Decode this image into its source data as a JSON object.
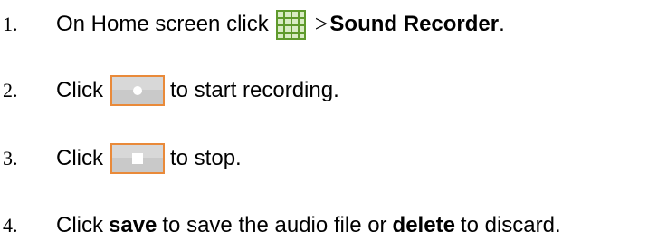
{
  "steps": [
    {
      "number": "1.",
      "before": "On Home screen click",
      "arrow": ">",
      "bold_after": "Sound Recorder",
      "end": ".",
      "icon": "app-grid-icon"
    },
    {
      "number": "2.",
      "before": "Click",
      "after": "to start recording.",
      "icon": "record-button-icon"
    },
    {
      "number": "3.",
      "before": "Click",
      "after": "to stop.",
      "icon": "stop-button-icon"
    },
    {
      "number": "4.",
      "before": "Click",
      "bold1": "save",
      "middle": "to save the audio file or",
      "bold2": "delete",
      "end": "to discard."
    }
  ],
  "colors": {
    "grid_green": "#6aa332",
    "button_face": "#b7b7b7",
    "button_side": "#e07b2e",
    "text": "#000000"
  }
}
